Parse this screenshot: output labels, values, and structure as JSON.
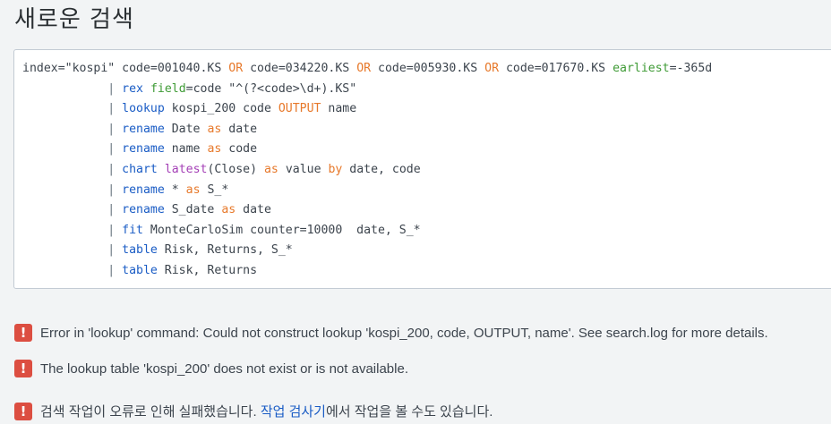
{
  "page": {
    "title": "새로운 검색"
  },
  "editor": {
    "lines": [
      [
        {
          "t": "text",
          "v": "index=\"kospi\" code=001040.KS "
        },
        {
          "t": "op",
          "v": "OR"
        },
        {
          "t": "text",
          "v": " code=034220.KS "
        },
        {
          "t": "op",
          "v": "OR"
        },
        {
          "t": "text",
          "v": " code=005930.KS "
        },
        {
          "t": "op",
          "v": "OR"
        },
        {
          "t": "text",
          "v": " code=017670.KS "
        },
        {
          "t": "arg",
          "v": "earliest"
        },
        {
          "t": "text",
          "v": "=-365d"
        }
      ],
      [
        {
          "t": "pipe",
          "v": "            | "
        },
        {
          "t": "cmd",
          "v": "rex"
        },
        {
          "t": "text",
          "v": " "
        },
        {
          "t": "arg",
          "v": "field"
        },
        {
          "t": "text",
          "v": "=code \"^(?<code>\\d+).KS\""
        }
      ],
      [
        {
          "t": "pipe",
          "v": "            | "
        },
        {
          "t": "cmd",
          "v": "lookup"
        },
        {
          "t": "text",
          "v": " kospi_200 code "
        },
        {
          "t": "op",
          "v": "OUTPUT"
        },
        {
          "t": "text",
          "v": " name"
        }
      ],
      [
        {
          "t": "pipe",
          "v": "            | "
        },
        {
          "t": "cmd",
          "v": "rename"
        },
        {
          "t": "text",
          "v": " Date "
        },
        {
          "t": "op",
          "v": "as"
        },
        {
          "t": "text",
          "v": " date"
        }
      ],
      [
        {
          "t": "pipe",
          "v": "            | "
        },
        {
          "t": "cmd",
          "v": "rename"
        },
        {
          "t": "text",
          "v": " name "
        },
        {
          "t": "op",
          "v": "as"
        },
        {
          "t": "text",
          "v": " code"
        }
      ],
      [
        {
          "t": "pipe",
          "v": "            | "
        },
        {
          "t": "cmd",
          "v": "chart"
        },
        {
          "t": "text",
          "v": " "
        },
        {
          "t": "fn",
          "v": "latest"
        },
        {
          "t": "text",
          "v": "(Close) "
        },
        {
          "t": "op",
          "v": "as"
        },
        {
          "t": "text",
          "v": " value "
        },
        {
          "t": "op",
          "v": "by"
        },
        {
          "t": "text",
          "v": " date, code"
        }
      ],
      [
        {
          "t": "pipe",
          "v": "            | "
        },
        {
          "t": "cmd",
          "v": "rename"
        },
        {
          "t": "text",
          "v": " * "
        },
        {
          "t": "op",
          "v": "as"
        },
        {
          "t": "text",
          "v": " S_*"
        }
      ],
      [
        {
          "t": "pipe",
          "v": "            | "
        },
        {
          "t": "cmd",
          "v": "rename"
        },
        {
          "t": "text",
          "v": " S_date "
        },
        {
          "t": "op",
          "v": "as"
        },
        {
          "t": "text",
          "v": " date"
        }
      ],
      [
        {
          "t": "pipe",
          "v": "            | "
        },
        {
          "t": "cmd",
          "v": "fit"
        },
        {
          "t": "text",
          "v": " MonteCarloSim counter=10000  date, S_*"
        }
      ],
      [
        {
          "t": "pipe",
          "v": "            | "
        },
        {
          "t": "cmd",
          "v": "table"
        },
        {
          "t": "text",
          "v": " Risk, Returns, S_*"
        }
      ],
      [
        {
          "t": "pipe",
          "v": "            | "
        },
        {
          "t": "cmd",
          "v": "table"
        },
        {
          "t": "text",
          "v": " Risk, Returns"
        }
      ]
    ]
  },
  "messages": {
    "m1": {
      "icon": "!",
      "text": "Error in 'lookup' command: Could not construct lookup 'kospi_200, code, OUTPUT, name'. See search.log for more details."
    },
    "m2": {
      "icon": "!",
      "text": "The lookup table 'kospi_200' does not exist or is not available."
    },
    "m3": {
      "icon": "!",
      "text_before": "검색 작업이 오류로 인해 실패했습니다. ",
      "link": "작업 검사기",
      "text_after": "에서 작업을 볼 수도 있습니다."
    }
  },
  "colors": {
    "command": "#1a5cc5",
    "operator": "#e7792b",
    "argument": "#3f9b36",
    "function": "#a43fb6",
    "error": "#dc4e41",
    "link": "#1a5cc5"
  }
}
